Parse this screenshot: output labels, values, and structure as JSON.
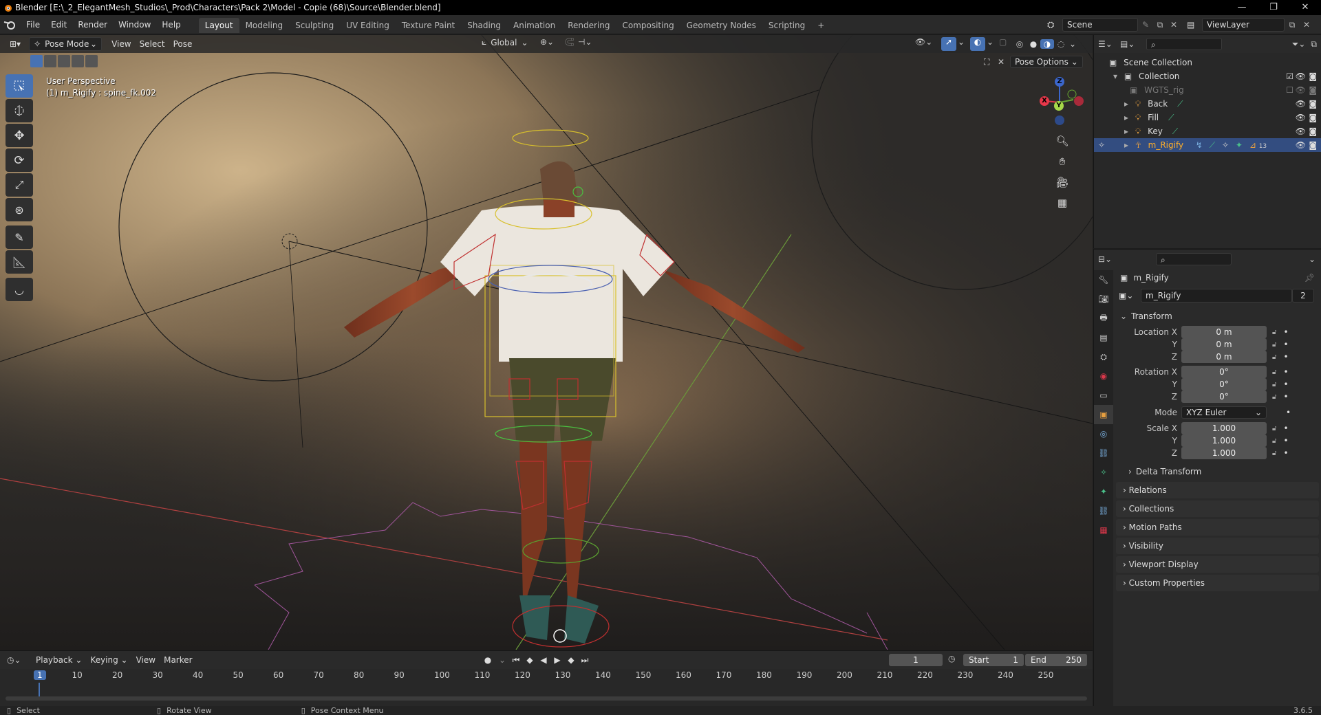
{
  "window": {
    "title": "Blender [E:\\_2_ElegantMesh_Studios\\_Prod\\Characters\\Pack 2\\Model - Copie (68)\\Source\\Blender.blend]",
    "controls": [
      "—",
      "❐",
      "✕"
    ]
  },
  "menubar": {
    "items": [
      "File",
      "Edit",
      "Render",
      "Window",
      "Help"
    ]
  },
  "workspaces": {
    "tabs": [
      "Layout",
      "Modeling",
      "Sculpting",
      "UV Editing",
      "Texture Paint",
      "Shading",
      "Animation",
      "Rendering",
      "Compositing",
      "Geometry Nodes",
      "Scripting"
    ],
    "active": "Layout",
    "add": "+"
  },
  "scene": {
    "name": "Scene"
  },
  "view_layer": {
    "name": "ViewLayer"
  },
  "viewport": {
    "mode": "Pose Mode",
    "menus": [
      "View",
      "Select",
      "Pose"
    ],
    "orientation": "Global",
    "pose_options": "Pose Options",
    "perspective": "User Perspective",
    "active_info": "(1) m_Rigify : spine_fk.002",
    "gizmo_axes": {
      "z": "Z",
      "y": "Y",
      "x": "X"
    }
  },
  "tools": [
    "select-box",
    "cursor",
    "move",
    "rotate",
    "scale",
    "transform",
    "annotate",
    "measure",
    "bone-relax"
  ],
  "outliner": {
    "root": "Scene Collection",
    "items": [
      {
        "label": "Collection",
        "level": 1
      },
      {
        "label": "WGTS_rig",
        "level": 2,
        "dim": true
      },
      {
        "label": "Back",
        "level": 2
      },
      {
        "label": "Fill",
        "level": 2
      },
      {
        "label": "Key",
        "level": 2
      },
      {
        "label": "m_Rigify",
        "level": 2,
        "selected": true,
        "badge": "13"
      }
    ]
  },
  "properties": {
    "object_name": "m_Rigify",
    "data_name": "m_Rigify",
    "users": "2",
    "transform": {
      "header": "Transform",
      "location": {
        "label": "Location X",
        "x": "0 m",
        "y": "0 m",
        "z": "0 m"
      },
      "rotation": {
        "label": "Rotation X",
        "x": "0°",
        "y": "0°",
        "z": "0°"
      },
      "mode_label": "Mode",
      "mode_value": "XYZ Euler",
      "scale": {
        "label": "Scale X",
        "x": "1.000",
        "y": "1.000",
        "z": "1.000"
      },
      "axis_y": "Y",
      "axis_z": "Z",
      "delta": "Delta Transform"
    },
    "panels": [
      "Relations",
      "Collections",
      "Motion Paths",
      "Visibility",
      "Viewport Display",
      "Custom Properties"
    ]
  },
  "timeline": {
    "menus": [
      "Playback",
      "Keying",
      "View",
      "Marker"
    ],
    "current_frame": "1",
    "start_label": "Start",
    "start": "1",
    "end_label": "End",
    "end": "250",
    "ticks": [
      "1",
      "10",
      "20",
      "30",
      "40",
      "50",
      "60",
      "70",
      "80",
      "90",
      "100",
      "110",
      "120",
      "130",
      "140",
      "150",
      "160",
      "170",
      "180",
      "190",
      "200",
      "210",
      "220",
      "230",
      "240",
      "250"
    ]
  },
  "statusbar": {
    "select": "Select",
    "rotate": "Rotate View",
    "context": "Pose Context Menu",
    "version": "3.6.5"
  }
}
